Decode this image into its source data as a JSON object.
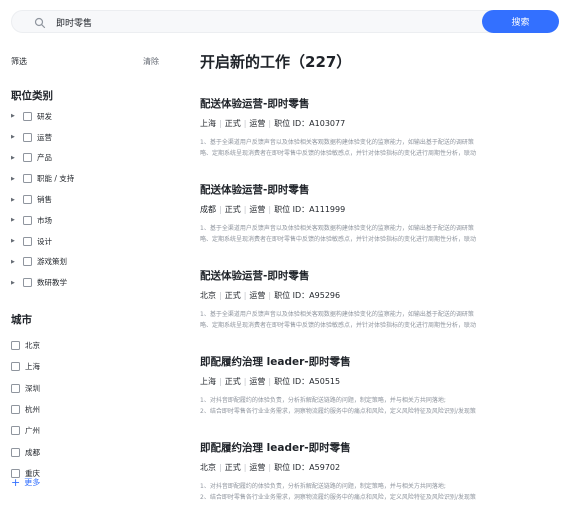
{
  "search": {
    "value": "即时零售",
    "button_label": "搜索"
  },
  "sidebar": {
    "filter_label": "筛选",
    "clear_label": "清除",
    "category_title": "职位类别",
    "categories": [
      {
        "label": "研发"
      },
      {
        "label": "运营"
      },
      {
        "label": "产品"
      },
      {
        "label": "职能 / 支持"
      },
      {
        "label": "销售"
      },
      {
        "label": "市场"
      },
      {
        "label": "设计"
      },
      {
        "label": "游戏策划"
      },
      {
        "label": "数研教学"
      }
    ],
    "city_title": "城市",
    "cities": [
      {
        "label": "北京"
      },
      {
        "label": "上海"
      },
      {
        "label": "深圳"
      },
      {
        "label": "杭州"
      },
      {
        "label": "广州"
      },
      {
        "label": "成都"
      },
      {
        "label": "重庆"
      }
    ],
    "more_label": "更多"
  },
  "main": {
    "title": "开启新的工作（227）",
    "jobs": [
      {
        "title": "配送体验运营-即时零售",
        "city": "上海",
        "type": "正式",
        "category": "运营",
        "id_text": "职位 ID：A103077",
        "desc_line1": "1、基于全渠道用户反馈声音以及体验相关客观数据构建体验变化的监察能力，如输出基于配送的调研策",
        "desc_line2": "略、定期系统呈现消费者在即时零售中反馈的体验敏感点，并针对体验指标的变化进行周期性分析，联动"
      },
      {
        "title": "配送体验运营-即时零售",
        "city": "成都",
        "type": "正式",
        "category": "运营",
        "id_text": "职位 ID：A111999",
        "desc_line1": "1、基于全渠道用户反馈声音以及体验相关客观数据构建体验变化的监察能力，如输出基于配送的调研策",
        "desc_line2": "略、定期系统呈现消费者在即时零售中反馈的体验敏感点，并针对体验指标的变化进行周期性分析，联动"
      },
      {
        "title": "配送体验运营-即时零售",
        "city": "北京",
        "type": "正式",
        "category": "运营",
        "id_text": "职位 ID：A95296",
        "desc_line1": "1、基于全渠道用户反馈声音以及体验相关客观数据构建体验变化的监察能力，如输出基于配送的调研策",
        "desc_line2": "略、定期系统呈现消费者在即时零售中反馈的体验敏感点，并针对体验指标的变化进行周期性分析，联动"
      },
      {
        "title": "即配履约治理 leader-即时零售",
        "city": "上海",
        "type": "正式",
        "category": "运营",
        "id_text": "职位 ID：A50515",
        "desc_line1": "1、对抖音即配履约的体验负责，分析拆解配送链路的问题，制定策略，并与相关方共同落地;",
        "desc_line2": "2、结合即时零售各行业业务需求，洞察物流履约服务中的痛点和风险，定义风险特征及风险识别/发现策"
      },
      {
        "title": "即配履约治理 leader-即时零售",
        "city": "北京",
        "type": "正式",
        "category": "运营",
        "id_text": "职位 ID：A59702",
        "desc_line1": "1、对抖音即配履约的体验负责，分析拆解配送链路的问题，制定策略，并与相关方共同落地;",
        "desc_line2": "2、结合即时零售各行业业务需求，洞察物流履约服务中的痛点和风险，定义风险特征及风险识别/发现策"
      }
    ]
  }
}
